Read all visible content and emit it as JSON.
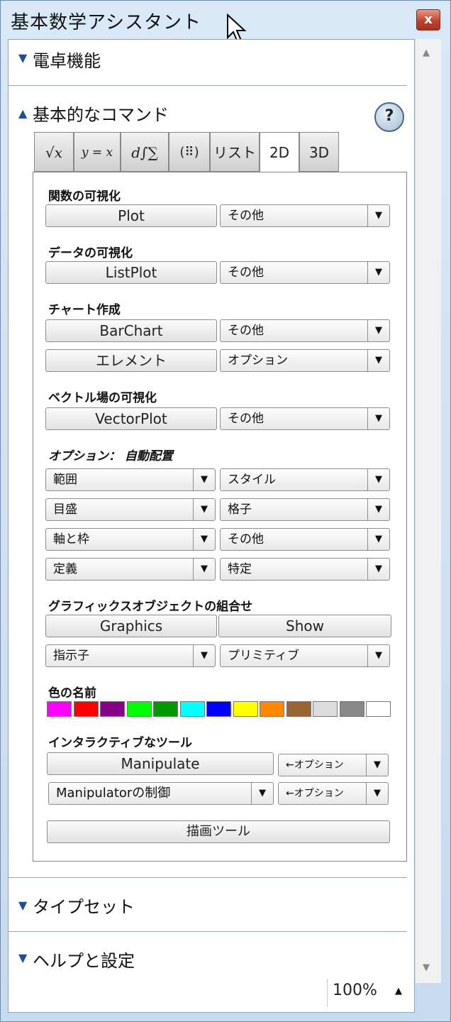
{
  "window": {
    "title": "基本数学アシスタント",
    "close_label": "x"
  },
  "sections": {
    "calculator": "電卓機能",
    "basic_commands": "基本的なコマンド",
    "typeset": "タイプセット",
    "help_settings": "ヘルプと設定"
  },
  "help_label": "?",
  "tabs": [
    "√x",
    "y = x",
    "d∫∑",
    "(⠿)",
    "リスト",
    "2D",
    "3D"
  ],
  "active_tab": "2D",
  "groups": {
    "function_viz": "関数の可視化",
    "data_viz": "データの可視化",
    "chart": "チャート作成",
    "vector_viz": "ベクトル場の可視化",
    "options": "オプション： 自動配置",
    "graphics_combo": "グラフィックスオブジェクトの組合せ",
    "color_names": "色の名前",
    "interactive": "インタラクティブなツール"
  },
  "buttons": {
    "plot": "Plot",
    "listplot": "ListPlot",
    "barchart": "BarChart",
    "element": "エレメント",
    "vectorplot": "VectorPlot",
    "graphics": "Graphics",
    "show": "Show",
    "manipulate": "Manipulate",
    "draw_tools": "描画ツール"
  },
  "dropdowns": {
    "plot_more": "その他",
    "listplot_more": "その他",
    "barchart_more": "その他",
    "element_options": "オプション",
    "vector_more": "その他",
    "range": "範囲",
    "style": "スタイル",
    "ticks": "目盛",
    "grid": "格子",
    "axes_frame": "軸と枠",
    "opt_more": "その他",
    "definition": "定義",
    "specific": "特定",
    "directive": "指示子",
    "primitive": "プリミティブ",
    "manip_options": "←オプション",
    "manipulator_control": "Manipulatorの制御",
    "manipulator_options": "←オプション"
  },
  "colors": [
    "#ff00ff",
    "#ff0000",
    "#880088",
    "#00ff00",
    "#009900",
    "#00ffff",
    "#0000ff",
    "#ffff00",
    "#ff8800",
    "#996633",
    "#dddddd",
    "#888888",
    "#ffffff"
  ],
  "zoom": "100%"
}
